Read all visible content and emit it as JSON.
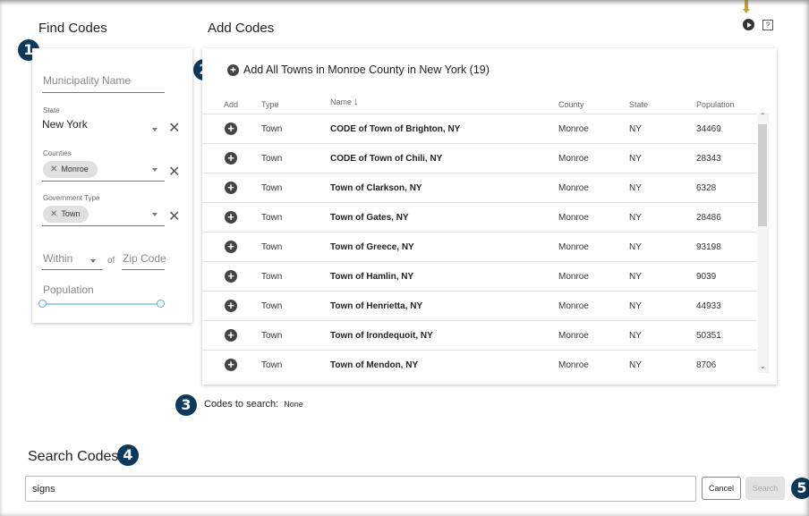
{
  "find_codes": {
    "title": "Find Codes",
    "municipality_placeholder": "Municipality Name",
    "state_label": "State",
    "state_value": "New York",
    "counties_label": "Counties",
    "counties_chip": "Monroe",
    "gov_type_label": "Government Type",
    "gov_type_chip": "Town",
    "within_placeholder": "Within",
    "of_label": "of",
    "zip_placeholder": "Zip Code",
    "population_label": "Population"
  },
  "add_codes": {
    "title": "Add Codes",
    "add_all_label": "Add All Towns in Monroe County in New York (19)",
    "columns": {
      "add": "Add",
      "type": "Type",
      "name": "Name",
      "county": "County",
      "state": "State",
      "population": "Population"
    },
    "rows": [
      {
        "type": "Town",
        "name": "CODE of Town of Brighton, NY",
        "county": "Monroe",
        "state": "NY",
        "population": "34469"
      },
      {
        "type": "Town",
        "name": "CODE of Town of Chili, NY",
        "county": "Monroe",
        "state": "NY",
        "population": "28343"
      },
      {
        "type": "Town",
        "name": "Town of Clarkson, NY",
        "county": "Monroe",
        "state": "NY",
        "population": "6328"
      },
      {
        "type": "Town",
        "name": "Town of Gates, NY",
        "county": "Monroe",
        "state": "NY",
        "population": "28486"
      },
      {
        "type": "Town",
        "name": "Town of Greece, NY",
        "county": "Monroe",
        "state": "NY",
        "population": "93198"
      },
      {
        "type": "Town",
        "name": "Town of Hamlin, NY",
        "county": "Monroe",
        "state": "NY",
        "population": "9039"
      },
      {
        "type": "Town",
        "name": "Town of Henrietta, NY",
        "county": "Monroe",
        "state": "NY",
        "population": "44933"
      },
      {
        "type": "Town",
        "name": "Town of Irondequoit, NY",
        "county": "Monroe",
        "state": "NY",
        "population": "50351"
      },
      {
        "type": "Town",
        "name": "Town of Mendon, NY",
        "county": "Monroe",
        "state": "NY",
        "population": "8706"
      }
    ]
  },
  "codes_to_search": {
    "label": "Codes to search:",
    "value": "None"
  },
  "search_codes": {
    "title": "Search Codes",
    "input_value": "signs",
    "cancel_label": "Cancel",
    "search_label": "Search"
  },
  "badges": [
    "1",
    "2",
    "3",
    "4",
    "5"
  ],
  "icons": {
    "help": "?"
  },
  "colors": {
    "badge": "#0d3a5c",
    "slider": "#4ab0d8",
    "accent_marker": "#c8a13a"
  }
}
